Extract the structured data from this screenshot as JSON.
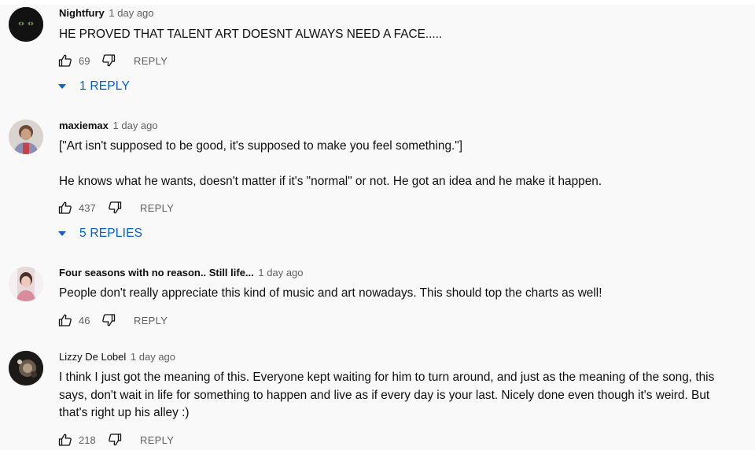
{
  "comments": [
    {
      "author": "Nightfury",
      "time": "1 day ago",
      "paragraphs": [
        "HE PROVED THAT TALENT ART DOESNT ALWAYS NEED A FACE....."
      ],
      "likes": "69",
      "reply_label": "REPLY",
      "replies_toggle": "1 REPLY",
      "avatar_icon": "dark-cat-eyes-avatar"
    },
    {
      "author": "maxiemax",
      "time": "1 day ago",
      "paragraphs": [
        "[\"Art isn't supposed to be good, it's supposed to make you feel something.\"]",
        "He knows what he wants, doesn't matter if it's \"normal\" or not. He got an idea and he make it happen."
      ],
      "likes": "437",
      "reply_label": "REPLY",
      "replies_toggle": "5 REPLIES",
      "avatar_icon": "person-photo-avatar"
    },
    {
      "author": "Four seasons with no reason.. Still life...",
      "time": "1 day ago",
      "paragraphs": [
        "People don't really appreciate this kind of music and art nowadays.  This should top the charts as well!"
      ],
      "likes": "46",
      "reply_label": "REPLY",
      "avatar_icon": "person-photo-avatar"
    },
    {
      "author": "Lizzy De Lobel",
      "time": "1 day ago",
      "paragraphs": [
        "I think I just got the meaning of this. Everyone kept waiting for him to turn around, and just as the meaning of the song, this says, don't wait in life for something to happen and live as if every day is your last. Nicely done even though it's weird. But that's right up his alley :)"
      ],
      "likes": "218",
      "reply_label": "REPLY",
      "avatar_icon": "dark-photo-avatar"
    }
  ],
  "colors": {
    "background": "#f9f9f9",
    "link_blue": "#065fd4",
    "secondary_text": "#606060"
  }
}
